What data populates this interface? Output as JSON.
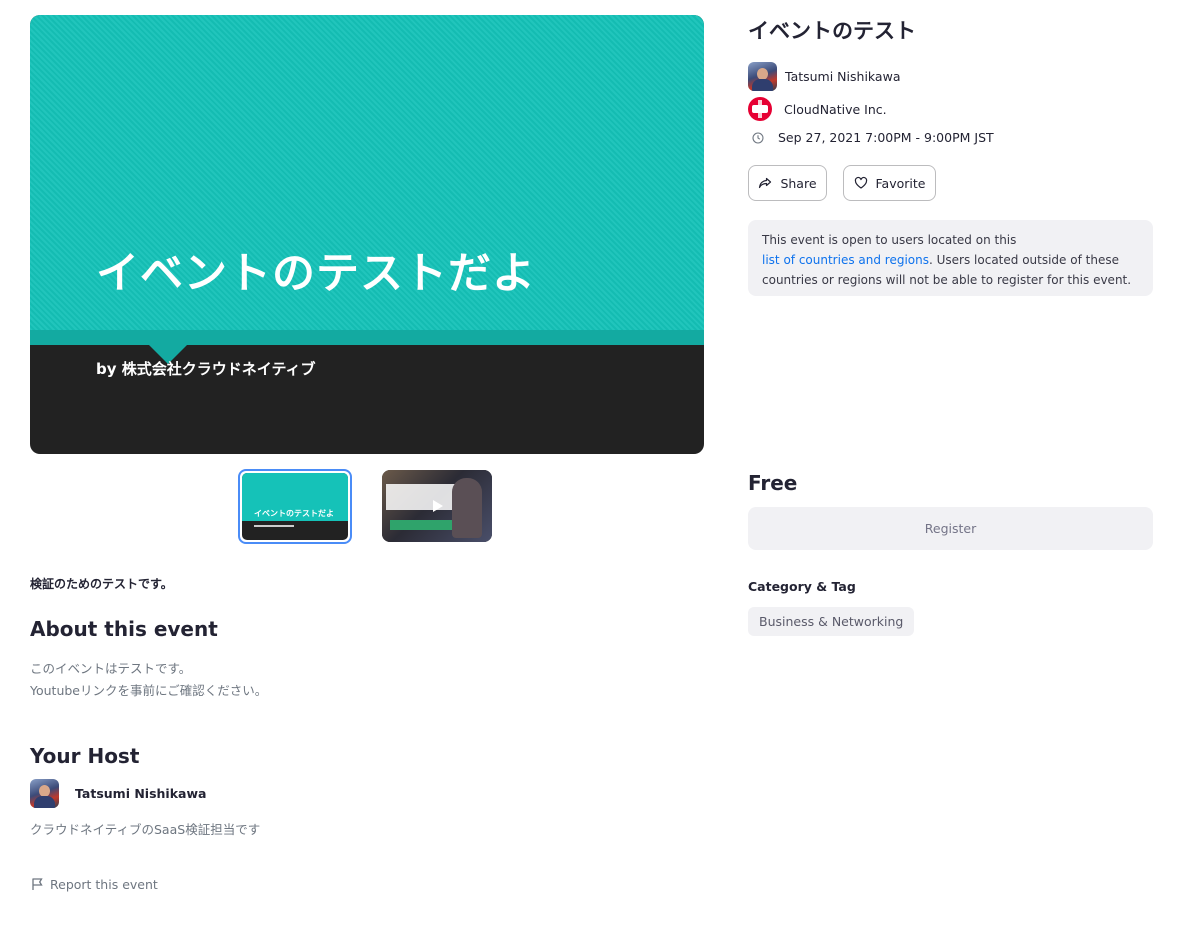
{
  "hero": {
    "title": "イベントのテストだよ",
    "subtitle": "by 株式会社クラウドネイティブ"
  },
  "thumbnails": [
    {
      "caption": "イベントのテストだよ",
      "selected": true
    },
    {
      "caption": "",
      "selected": false
    }
  ],
  "summary": "検証のためのテストです。",
  "about": {
    "heading": "About this event",
    "lines": [
      "このイベントはテストです。",
      "Youtubeリンクを事前にご確認ください。"
    ]
  },
  "host_section": {
    "heading": "Your Host",
    "name": "Tatsumi Nishikawa",
    "bio": "クラウドネイティブのSaaS検証担当です"
  },
  "report_label": "Report this event",
  "event": {
    "title": "イベントのテスト",
    "host_name": "Tatsumi Nishikawa",
    "organization": "CloudNative Inc.",
    "datetime": "Sep 27, 2021 7:00PM - 9:00PM JST"
  },
  "actions": {
    "share_label": "Share",
    "favorite_label": "Favorite"
  },
  "notice": {
    "prefix": "This event is open to users located on this",
    "link_text": "list of countries and regions",
    "suffix": ". Users located outside of these countries or regions will not be able to register for this event."
  },
  "ticket": {
    "price": "Free",
    "register_label": "Register"
  },
  "category": {
    "heading": "Category & Tag",
    "tags": [
      "Business & Networking"
    ]
  },
  "colors": {
    "accent_link": "#0e72ed",
    "hero_teal": "#15c2b8",
    "thumb_selected_border": "#4a8cf7"
  },
  "icons": {
    "share": "share-icon",
    "favorite": "heart-icon",
    "clock": "clock-icon",
    "report": "flag-icon",
    "play": "play-icon"
  }
}
